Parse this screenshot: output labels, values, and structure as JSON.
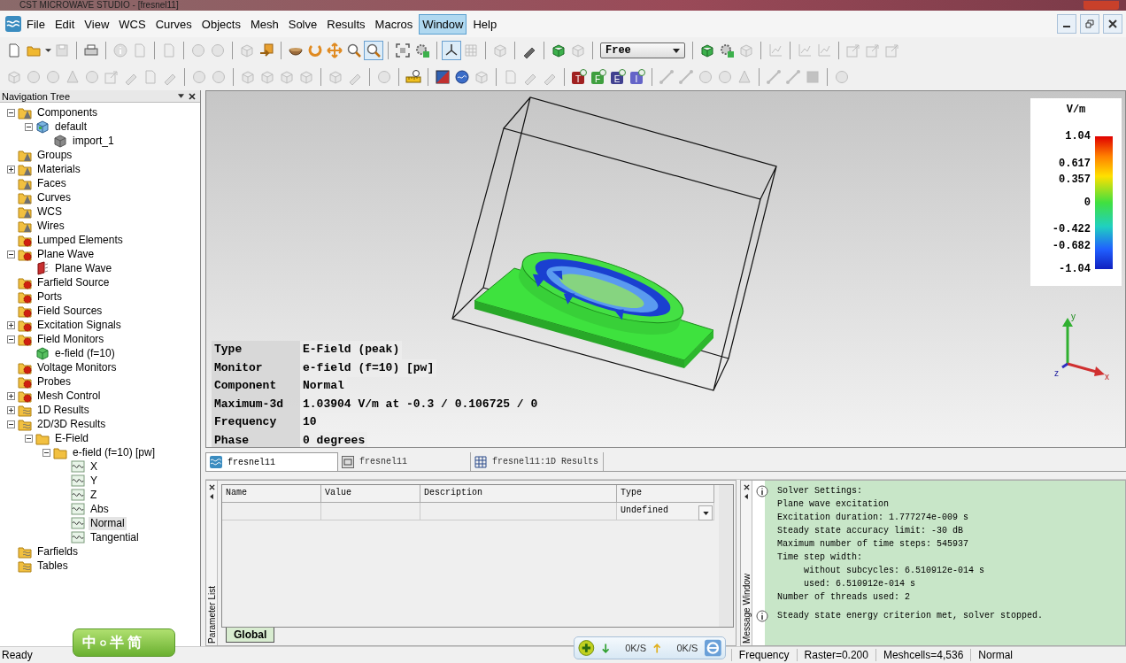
{
  "window": {
    "title": "CST MICROWAVE STUDIO - [fresnel11]"
  },
  "menu": [
    {
      "label": "File",
      "selected": false
    },
    {
      "label": "Edit",
      "selected": false
    },
    {
      "label": "View",
      "selected": false
    },
    {
      "label": "WCS",
      "selected": false
    },
    {
      "label": "Curves",
      "selected": false
    },
    {
      "label": "Objects",
      "selected": false
    },
    {
      "label": "Mesh",
      "selected": false
    },
    {
      "label": "Solve",
      "selected": false
    },
    {
      "label": "Results",
      "selected": false
    },
    {
      "label": "Macros",
      "selected": false
    },
    {
      "label": "Window",
      "selected": true
    },
    {
      "label": "Help",
      "selected": false
    }
  ],
  "toolbars": [
    {
      "groups": [
        [
          {
            "kind": "doc",
            "disabled": false,
            "selected": false
          },
          {
            "kind": "folder",
            "disabled": false,
            "selected": false
          },
          {
            "kind": "caret",
            "disabled": false,
            "selected": false
          },
          {
            "kind": "disk",
            "disabled": true,
            "selected": false
          }
        ],
        [
          {
            "kind": "printer",
            "disabled": false,
            "selected": false
          }
        ],
        [
          {
            "kind": "info",
            "disabled": true,
            "selected": false
          },
          {
            "kind": "doc",
            "disabled": true,
            "selected": false
          }
        ],
        [
          {
            "kind": "doc",
            "disabled": true,
            "selected": false
          }
        ],
        [
          {
            "kind": "circle",
            "disabled": true,
            "selected": false
          },
          {
            "kind": "circle",
            "disabled": true,
            "selected": false
          }
        ],
        [
          {
            "kind": "cube",
            "disabled": true,
            "selected": false
          },
          {
            "kind": "import",
            "disabled": false,
            "selected": false
          }
        ],
        [
          {
            "kind": "bowl",
            "disabled": false,
            "selected": false
          },
          {
            "kind": "rotate",
            "disabled": false,
            "selected": false
          },
          {
            "kind": "move",
            "disabled": false,
            "selected": false
          },
          {
            "kind": "zoom",
            "disabled": false,
            "selected": false
          },
          {
            "kind": "zoom",
            "disabled": false,
            "selected": true
          }
        ],
        [
          {
            "kind": "fit",
            "disabled": false,
            "selected": false
          },
          {
            "kind": "gear",
            "disabled": false,
            "selected": false
          }
        ],
        [
          {
            "kind": "axes",
            "disabled": false,
            "selected": true
          },
          {
            "kind": "grid",
            "disabled": true,
            "selected": false
          }
        ],
        [
          {
            "kind": "cube",
            "disabled": true,
            "selected": false
          }
        ],
        [
          {
            "kind": "brush",
            "disabled": false,
            "selected": false
          }
        ],
        [
          {
            "kind": "greencube",
            "disabled": false,
            "selected": false
          },
          {
            "kind": "cube",
            "disabled": true,
            "selected": false
          }
        ],
        [
          {
            "kind": "combo",
            "value": "Free"
          }
        ],
        [
          {
            "kind": "greencube",
            "disabled": false,
            "selected": false
          },
          {
            "kind": "gear",
            "disabled": false,
            "selected": false
          },
          {
            "kind": "cube",
            "disabled": true,
            "selected": false
          }
        ],
        [
          {
            "kind": "chart",
            "disabled": true,
            "selected": false
          }
        ],
        [
          {
            "kind": "chart",
            "disabled": true,
            "selected": false
          },
          {
            "kind": "chart",
            "disabled": true,
            "selected": false
          }
        ],
        [
          {
            "kind": "export",
            "disabled": true,
            "selected": false
          },
          {
            "kind": "export",
            "disabled": true,
            "selected": false
          },
          {
            "kind": "export",
            "disabled": true,
            "selected": false
          }
        ]
      ]
    },
    {
      "groups": [
        [
          {
            "kind": "cube",
            "disabled": true,
            "selected": false
          },
          {
            "kind": "circle",
            "disabled": true,
            "selected": false
          },
          {
            "kind": "circle",
            "disabled": true,
            "selected": false
          },
          {
            "kind": "shape",
            "disabled": true,
            "selected": false
          },
          {
            "kind": "circle",
            "disabled": true,
            "selected": false
          },
          {
            "kind": "export",
            "disabled": true,
            "selected": false
          },
          {
            "kind": "brush",
            "disabled": true,
            "selected": false
          },
          {
            "kind": "doc",
            "disabled": true,
            "selected": false
          },
          {
            "kind": "brush",
            "disabled": true,
            "selected": false
          }
        ],
        [
          {
            "kind": "circle",
            "disabled": true,
            "selected": false
          },
          {
            "kind": "circle",
            "disabled": true,
            "selected": false
          }
        ],
        [
          {
            "kind": "cube",
            "disabled": true,
            "selected": false
          },
          {
            "kind": "cube",
            "disabled": true,
            "selected": false
          },
          {
            "kind": "cube",
            "disabled": true,
            "selected": false
          },
          {
            "kind": "cube",
            "disabled": true,
            "selected": false
          }
        ],
        [
          {
            "kind": "cube",
            "disabled": true,
            "selected": false
          },
          {
            "kind": "brush",
            "disabled": true,
            "selected": false
          }
        ],
        [
          {
            "kind": "circle",
            "disabled": true,
            "selected": false
          }
        ],
        [
          {
            "kind": "ruler",
            "disabled": false,
            "selected": false
          }
        ],
        [
          {
            "kind": "paint",
            "disabled": false,
            "selected": false
          },
          {
            "kind": "globe",
            "disabled": false,
            "selected": false
          },
          {
            "kind": "cube",
            "disabled": true,
            "selected": false
          }
        ],
        [
          {
            "kind": "doc",
            "disabled": true,
            "selected": false
          },
          {
            "kind": "brush",
            "disabled": true,
            "selected": false
          },
          {
            "kind": "brush",
            "disabled": true,
            "selected": false
          }
        ],
        [
          {
            "kind": "letter",
            "label": "T",
            "color": "#a02020",
            "disabled": false,
            "selected": false
          },
          {
            "kind": "letter",
            "label": "F",
            "color": "#3f9f3f",
            "disabled": false,
            "selected": false
          },
          {
            "kind": "letter",
            "label": "E",
            "color": "#404090",
            "disabled": false,
            "selected": false
          },
          {
            "kind": "letter",
            "label": "I",
            "color": "#6464c8",
            "disabled": false,
            "selected": false
          }
        ],
        [
          {
            "kind": "line",
            "disabled": true,
            "selected": false
          },
          {
            "kind": "line",
            "disabled": true,
            "selected": false
          },
          {
            "kind": "circle",
            "disabled": true,
            "selected": false
          },
          {
            "kind": "circle",
            "disabled": true,
            "selected": false
          },
          {
            "kind": "shape",
            "disabled": true,
            "selected": false
          }
        ],
        [
          {
            "kind": "line",
            "disabled": true,
            "selected": false
          },
          {
            "kind": "line",
            "disabled": true,
            "selected": false
          },
          {
            "kind": "square",
            "disabled": true,
            "selected": false
          }
        ],
        [
          {
            "kind": "circle",
            "disabled": true,
            "selected": false
          }
        ]
      ]
    }
  ],
  "navigation_tree": {
    "title": "Navigation Tree",
    "items": [
      {
        "label": "Components",
        "kind": "folder-cone",
        "expanded": true,
        "selected": false,
        "children": [
          {
            "label": "default",
            "kind": "block",
            "expanded": true,
            "selected": false,
            "children": [
              {
                "label": "import_1",
                "kind": "solid",
                "selected": false
              }
            ]
          }
        ]
      },
      {
        "label": "Groups",
        "kind": "folder-cone",
        "selected": false
      },
      {
        "label": "Materials",
        "kind": "folder-cone",
        "expanded": false,
        "selected": false
      },
      {
        "label": "Faces",
        "kind": "folder-cone",
        "selected": false
      },
      {
        "label": "Curves",
        "kind": "folder-cone",
        "selected": false
      },
      {
        "label": "WCS",
        "kind": "folder-cone",
        "selected": false
      },
      {
        "label": "Wires",
        "kind": "folder-cone",
        "selected": false
      },
      {
        "label": "Lumped Elements",
        "kind": "folder-star",
        "selected": false
      },
      {
        "label": "Plane Wave",
        "kind": "folder-star",
        "expanded": true,
        "selected": false,
        "children": [
          {
            "label": "Plane Wave",
            "kind": "planewave",
            "selected": false
          }
        ]
      },
      {
        "label": "Farfield Source",
        "kind": "folder-star",
        "selected": false
      },
      {
        "label": "Ports",
        "kind": "folder-star",
        "selected": false
      },
      {
        "label": "Field Sources",
        "kind": "folder-star",
        "selected": false
      },
      {
        "label": "Excitation Signals",
        "kind": "folder-star",
        "expanded": false,
        "selected": false
      },
      {
        "label": "Field Monitors",
        "kind": "folder-star",
        "expanded": true,
        "selected": false,
        "children": [
          {
            "label": "e-field (f=10)",
            "kind": "monitor",
            "selected": false
          }
        ]
      },
      {
        "label": "Voltage Monitors",
        "kind": "folder-star",
        "selected": false
      },
      {
        "label": "Probes",
        "kind": "folder-star",
        "selected": false
      },
      {
        "label": "Mesh Control",
        "kind": "folder-star",
        "expanded": false,
        "selected": false
      },
      {
        "label": "1D Results",
        "kind": "folder-wave",
        "expanded": false,
        "selected": false
      },
      {
        "label": "2D/3D Results",
        "kind": "folder-wave",
        "expanded": true,
        "selected": false,
        "children": [
          {
            "label": "E-Field",
            "kind": "folder",
            "expanded": true,
            "selected": false,
            "children": [
              {
                "label": "e-field (f=10) [pw]",
                "kind": "folder",
                "expanded": true,
                "selected": false,
                "children": [
                  {
                    "label": "X",
                    "kind": "field",
                    "selected": false
                  },
                  {
                    "label": "Y",
                    "kind": "field",
                    "selected": false
                  },
                  {
                    "label": "Z",
                    "kind": "field",
                    "selected": false
                  },
                  {
                    "label": "Abs",
                    "kind": "field",
                    "selected": false
                  },
                  {
                    "label": "Normal",
                    "kind": "field",
                    "selected": true
                  },
                  {
                    "label": "Tangential",
                    "kind": "field",
                    "selected": false
                  }
                ]
              }
            ]
          }
        ]
      },
      {
        "label": "Farfields",
        "kind": "folder-wave",
        "selected": false
      },
      {
        "label": "Tables",
        "kind": "folder-wave",
        "selected": false
      }
    ]
  },
  "view": {
    "legend": {
      "unit": "V/m",
      "ticks": [
        "1.04",
        "0.617",
        "0.357",
        "0",
        "-0.422",
        "-0.682",
        "-1.04"
      ]
    },
    "axes": {
      "y": "y",
      "z": "z",
      "x": "x"
    },
    "info": [
      {
        "label": "Type",
        "value": "E-Field (peak)"
      },
      {
        "label": "Monitor",
        "value": "e-field (f=10) [pw]"
      },
      {
        "label": "Component",
        "value": "Normal"
      },
      {
        "label": "Maximum-3d",
        "value": "1.03904 V/m at -0.3 / 0.106725 / 0"
      },
      {
        "label": "Frequency",
        "value": "10"
      },
      {
        "label": "Phase",
        "value": "0 degrees"
      }
    ]
  },
  "document_tabs": [
    {
      "label": "fresnel11",
      "kind": "model",
      "selected": true
    },
    {
      "label": "fresnel11",
      "kind": "schematic",
      "selected": false
    },
    {
      "label": "fresnel11:1D Results",
      "kind": "grid",
      "selected": false
    }
  ],
  "parameter_list": {
    "title": "Parameter List",
    "columns": [
      "Name",
      "Value",
      "Description",
      "Type"
    ],
    "new_row_type": "Undefined",
    "tab": "Global"
  },
  "message_window": {
    "title": "Message Window",
    "messages": [
      {
        "lines": [
          {
            "text": "Solver Settings:"
          },
          {
            "text": "Plane wave excitation"
          },
          {
            "text": "Excitation duration: 1.777274e-009 s"
          },
          {
            "text": "Steady state accuracy limit: -30 dB"
          },
          {
            "text": "Maximum number of time steps: 545937"
          },
          {
            "text": "Time step width:",
            "children": [
              {
                "text": "without subcycles: 6.510912e-014 s"
              },
              {
                "text": "used: 6.510912e-014 s"
              }
            ]
          },
          {
            "text": "Number of threads used: 2"
          }
        ]
      },
      {
        "lines": [
          {
            "text": "Steady state energy criterion met, solver stopped."
          }
        ]
      }
    ]
  },
  "status_bar": {
    "message": "Ready",
    "fields": [
      "Frequency",
      "Raster=0.200",
      "Meshcells=4,536",
      "Normal"
    ]
  },
  "ime_bar": {
    "items": [
      "中",
      "半",
      "简"
    ]
  },
  "network_meter": {
    "download": "0K/S",
    "upload": "0K/S"
  }
}
